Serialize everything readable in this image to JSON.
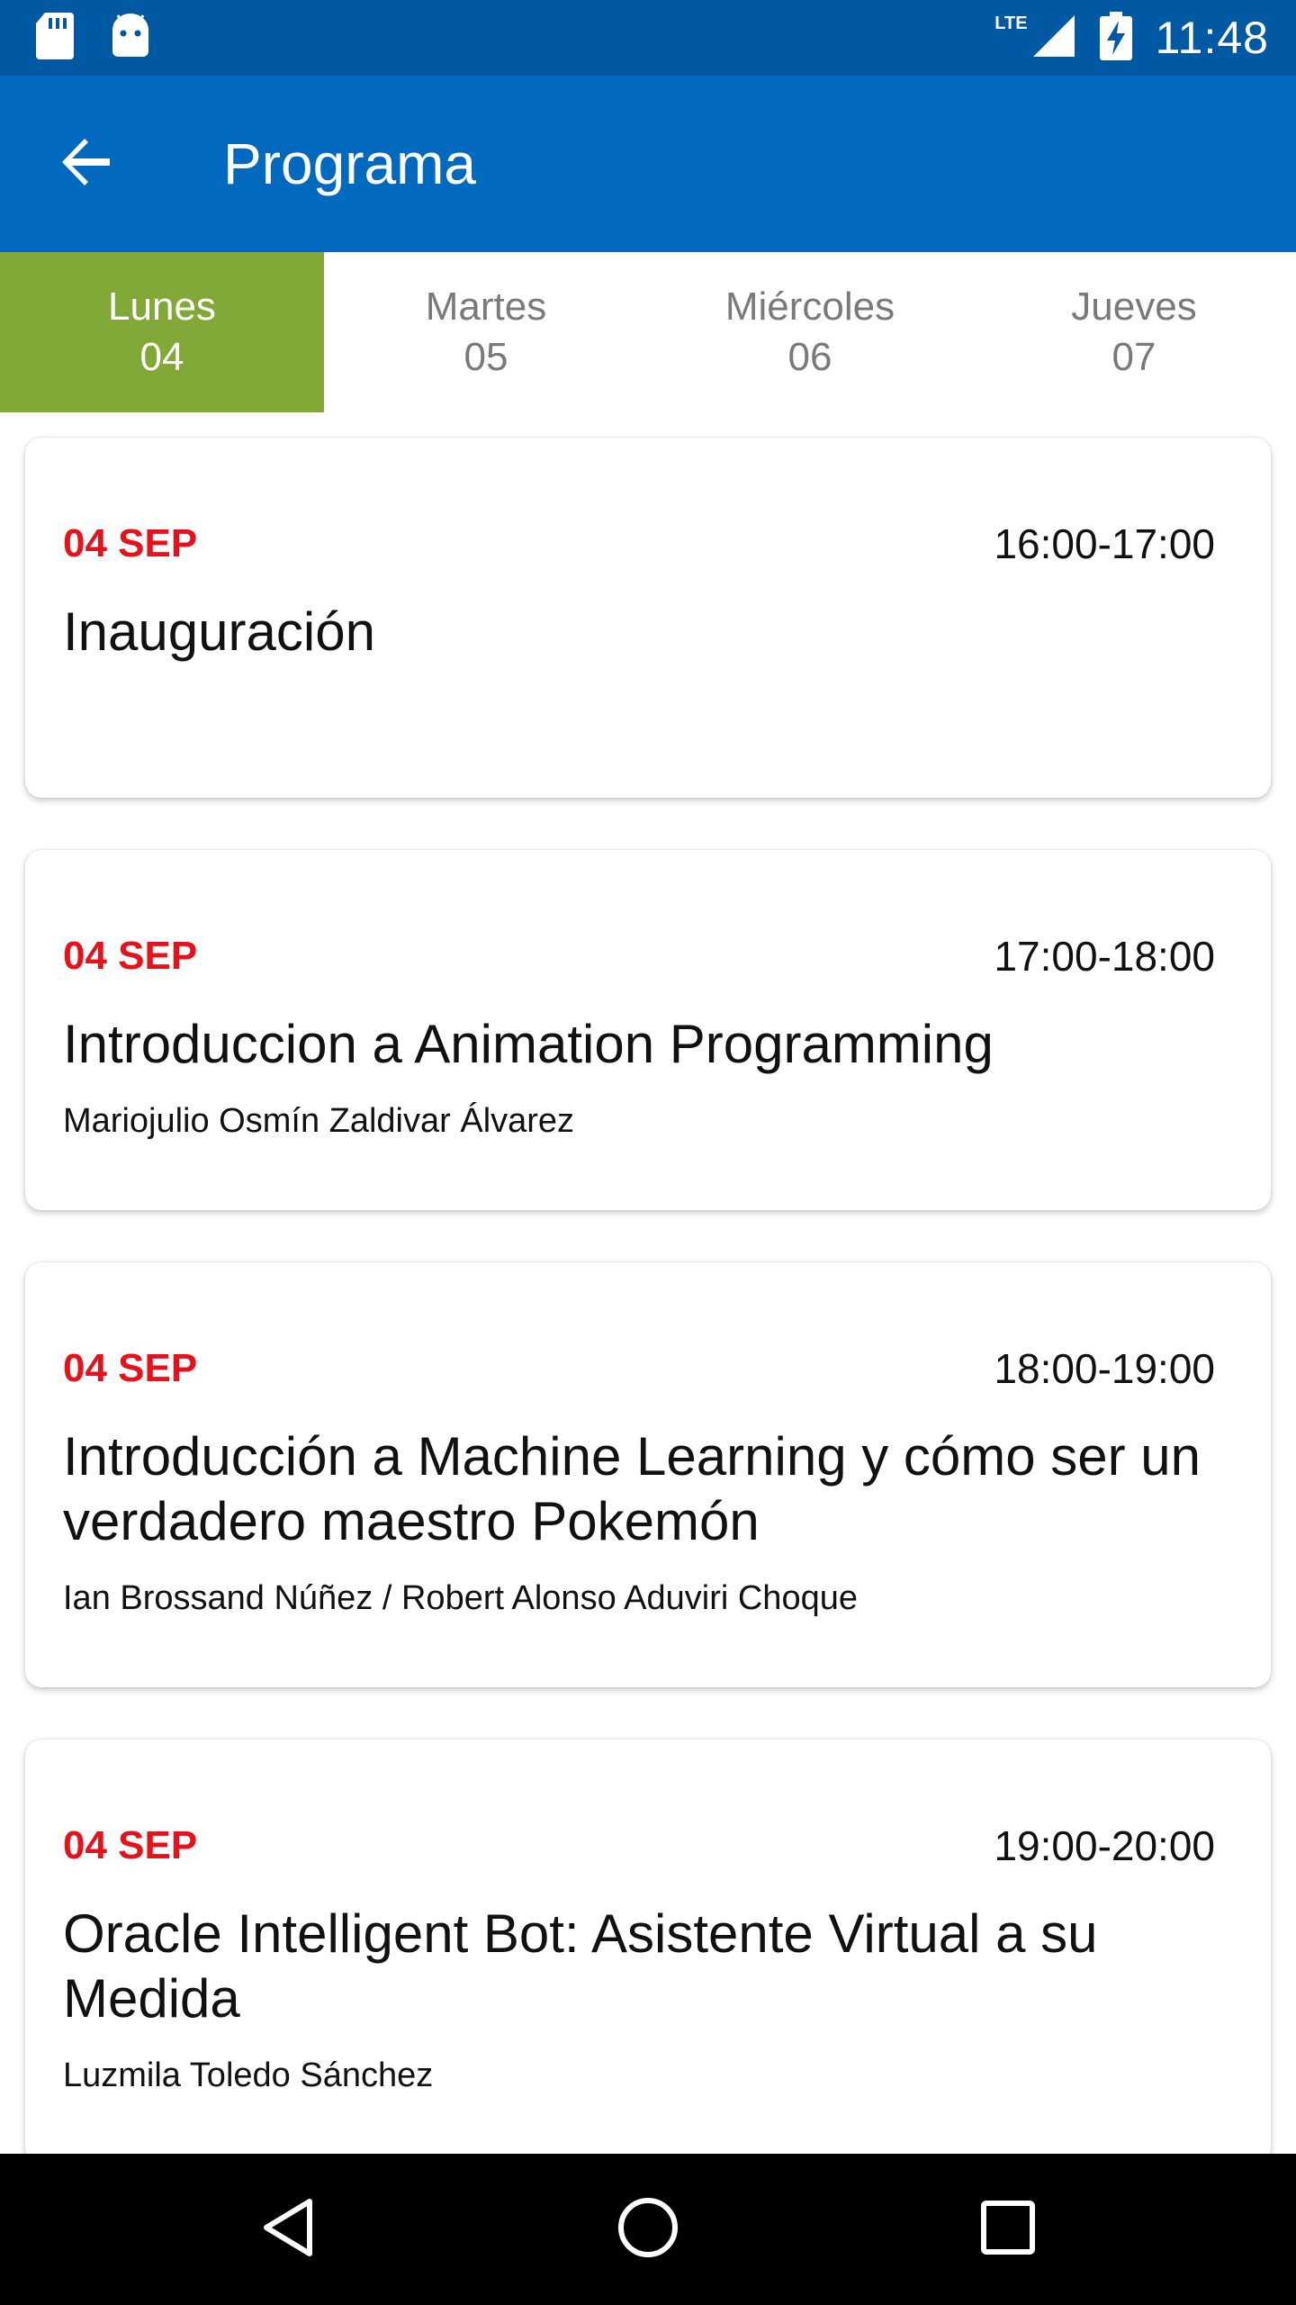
{
  "status_bar": {
    "time": "11:48",
    "network": "LTE",
    "icons": [
      "sd-card-icon",
      "android-icon",
      "signal-icon",
      "battery-charging-icon"
    ]
  },
  "app_bar": {
    "title": "Programa",
    "back_icon": "arrow-back-icon"
  },
  "tabs": [
    {
      "day": "Lunes",
      "num": "04",
      "active": true
    },
    {
      "day": "Martes",
      "num": "05",
      "active": false
    },
    {
      "day": "Miércoles",
      "num": "06",
      "active": false
    },
    {
      "day": "Jueves",
      "num": "07",
      "active": false
    }
  ],
  "sessions": [
    {
      "date": "04 SEP",
      "time": "16:00-17:00",
      "title": "Inauguración",
      "speaker": ""
    },
    {
      "date": "04 SEP",
      "time": "17:00-18:00",
      "title": "Introduccion a Animation Programming",
      "speaker": "Mariojulio Osmín Zaldivar Álvarez"
    },
    {
      "date": "04 SEP",
      "time": "18:00-19:00",
      "title": "Introducción a Machine Learning y cómo ser un verdadero maestro Pokemón",
      "speaker": "Ian Brossand Núñez / Robert Alonso Aduviri Choque"
    },
    {
      "date": "04 SEP",
      "time": "19:00-20:00",
      "title": "Oracle Intelligent Bot: Asistente Virtual a su Medida",
      "speaker": "Luzmila Toledo Sánchez"
    }
  ],
  "colors": {
    "status_bar": "#0158a3",
    "app_bar": "#016abe",
    "active_tab": "#82a838",
    "date_red": "#e8111b"
  },
  "nav_bar": {
    "icons": [
      "back-triangle-icon",
      "home-circle-icon",
      "recents-square-icon"
    ]
  }
}
